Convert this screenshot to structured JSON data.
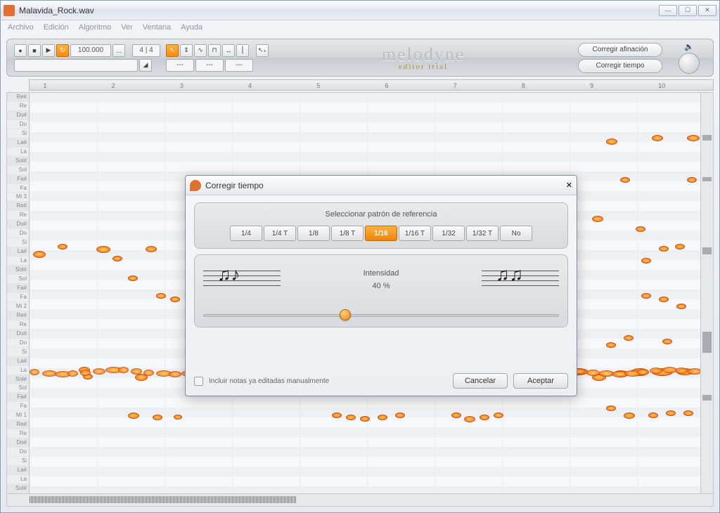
{
  "window": {
    "title": "Malavida_Rock.wav"
  },
  "menu": [
    "Archivo",
    "Edición",
    "Algoritmo",
    "Ver",
    "Ventana",
    "Ayuda"
  ],
  "toolbar": {
    "tempo": "100.000",
    "tempo_extra": "...",
    "time_sig": "4 | 4",
    "tool_fields": [
      "---",
      "---",
      "---"
    ]
  },
  "brand": {
    "line1": "melodyne",
    "line2": "editor trial"
  },
  "right_buttons": {
    "pitch": "Corregir afinación",
    "time": "Corregir tiempo"
  },
  "ruler_marks": [
    "1",
    "2",
    "3",
    "4",
    "5",
    "6",
    "7",
    "8",
    "9",
    "10"
  ],
  "pitch_rows": [
    {
      "l": "Re#",
      "s": true
    },
    {
      "l": "Re",
      "s": false
    },
    {
      "l": "Do#",
      "s": true
    },
    {
      "l": "Do",
      "s": false
    },
    {
      "l": "Si",
      "s": false
    },
    {
      "l": "La#",
      "s": true
    },
    {
      "l": "La",
      "s": false
    },
    {
      "l": "Sol#",
      "s": true
    },
    {
      "l": "Sol",
      "s": false
    },
    {
      "l": "Fa#",
      "s": true
    },
    {
      "l": "Fa",
      "s": false
    },
    {
      "l": "Mi 3",
      "s": false
    },
    {
      "l": "Re#",
      "s": true
    },
    {
      "l": "Re",
      "s": false
    },
    {
      "l": "Do#",
      "s": true
    },
    {
      "l": "Do",
      "s": false
    },
    {
      "l": "Si",
      "s": false
    },
    {
      "l": "La#",
      "s": true
    },
    {
      "l": "La",
      "s": false
    },
    {
      "l": "Sol#",
      "s": true
    },
    {
      "l": "Sol",
      "s": false
    },
    {
      "l": "Fa#",
      "s": true
    },
    {
      "l": "Fa",
      "s": false
    },
    {
      "l": "Mi 2",
      "s": false
    },
    {
      "l": "Re#",
      "s": true
    },
    {
      "l": "Re",
      "s": false
    },
    {
      "l": "Do#",
      "s": true
    },
    {
      "l": "Do",
      "s": false
    },
    {
      "l": "Si",
      "s": false
    },
    {
      "l": "La#",
      "s": true
    },
    {
      "l": "La",
      "s": false
    },
    {
      "l": "Sol#",
      "s": true
    },
    {
      "l": "Sol",
      "s": false
    },
    {
      "l": "Fa#",
      "s": true
    },
    {
      "l": "Fa",
      "s": false
    },
    {
      "l": "Mi 1",
      "s": false
    },
    {
      "l": "Re#",
      "s": true
    },
    {
      "l": "Re",
      "s": false
    },
    {
      "l": "Do#",
      "s": true
    },
    {
      "l": "Do",
      "s": false
    },
    {
      "l": "Si",
      "s": false
    },
    {
      "l": "La#",
      "s": true
    },
    {
      "l": "La",
      "s": false
    },
    {
      "l": "Sol#",
      "s": true
    }
  ],
  "dialog": {
    "title": "Corregir tiempo",
    "pattern_label": "Seleccionar patrón de referencia",
    "patterns": [
      "1/4",
      "1/4 T",
      "1/8",
      "1/8 T",
      "1/16",
      "1/16 T",
      "1/32",
      "1/32 T",
      "No"
    ],
    "selected_pattern": "1/16",
    "intensity_label": "Intensidad",
    "intensity_value_text": "40 %",
    "intensity_value": 40,
    "include_label": "Incluir notas ya editadas manualmente",
    "cancel": "Cancelar",
    "accept": "Aceptar"
  }
}
